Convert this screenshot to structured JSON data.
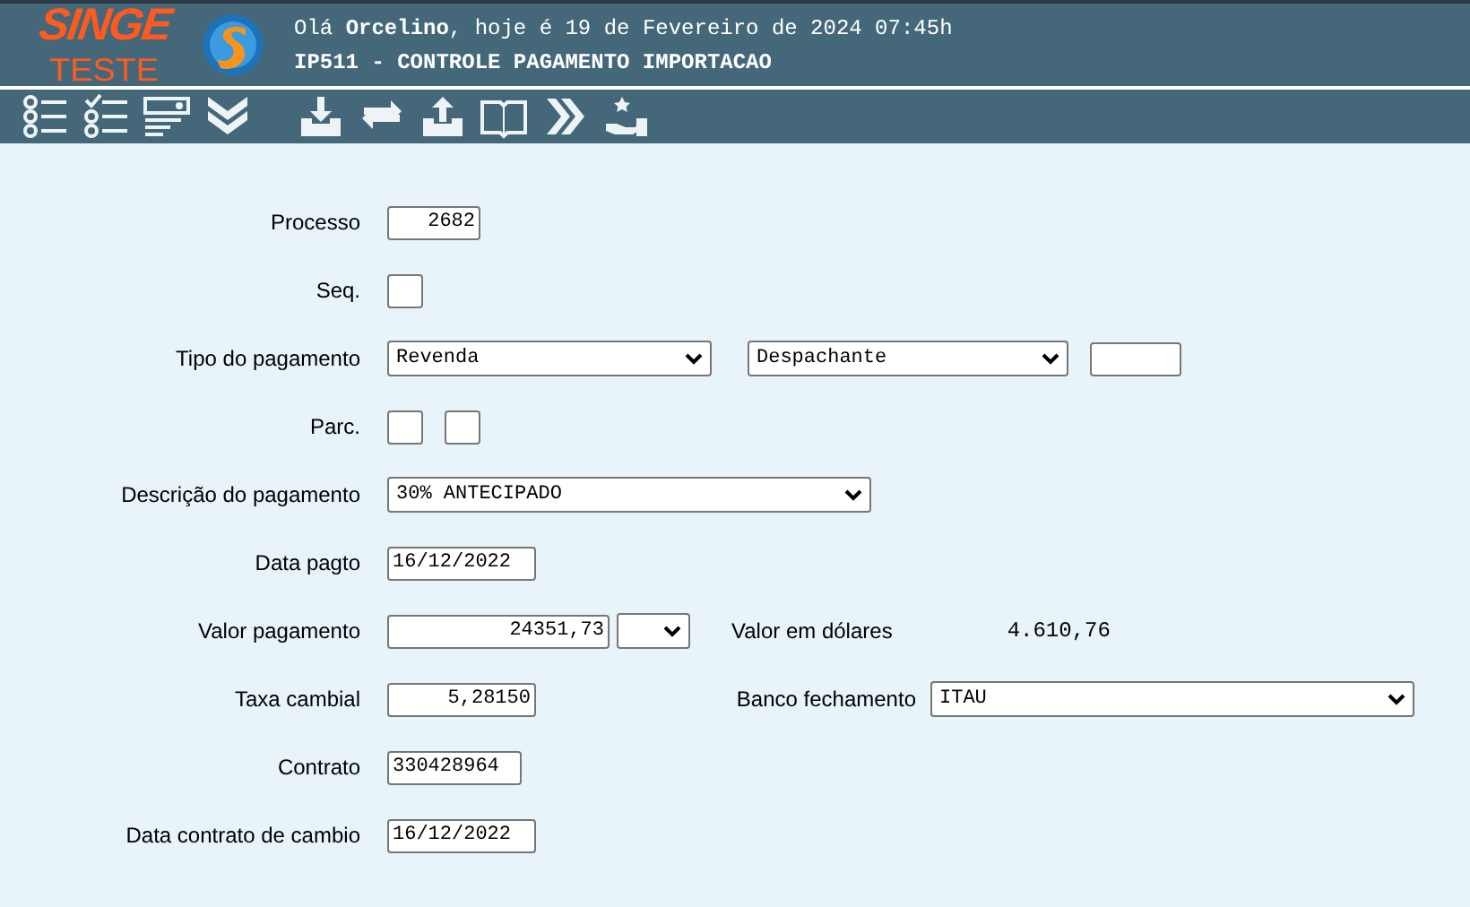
{
  "header": {
    "logo_top": "SINGE",
    "logo_bottom": "TESTE",
    "greeting": "Olá **Orcelino**, hoje é 19 de Fevereiro de 2024 07:45h",
    "title": "IP511 - CONTROLE PAGAMENTO IMPORTACAO"
  },
  "form": {
    "rows": [
      {
        "label": "Processo",
        "fields": [
          {
            "kind": "input",
            "value": "2682"
          }
        ]
      },
      {
        "label": "Seq.",
        "fields": [
          {
            "kind": "input"
          }
        ]
      },
      {
        "label": "Tipo do pagamento",
        "fields": [
          {
            "kind": "select",
            "value": "Revenda"
          },
          {
            "kind": "select",
            "value": "Despachante"
          },
          {
            "kind": "input"
          }
        ]
      },
      {
        "label": "Parc.",
        "fields": [
          {
            "kind": "input"
          },
          {
            "kind": "input"
          }
        ]
      },
      {
        "label": "Descrição do pagamento",
        "fields": [
          {
            "kind": "select",
            "value": "30% ANTECIPADO"
          }
        ]
      },
      {
        "label": "Data pagto",
        "fields": [
          {
            "kind": "input",
            "value": "16/12/2022"
          }
        ]
      },
      {
        "label": "Valor pagamento",
        "fields": [
          {
            "kind": "input",
            "value": "24351,73"
          },
          {
            "kind": "select"
          },
          {
            "kind": "label",
            "value": "Valor em dólares"
          },
          {
            "kind": "output",
            "value": "4.610,76"
          }
        ]
      },
      {
        "label": "Taxa cambial",
        "fields": [
          {
            "kind": "input",
            "value": "5,28150"
          },
          {
            "kind": "label",
            "value": "Banco fechamento"
          },
          {
            "kind": "select",
            "value": "ITAU"
          }
        ]
      },
      {
        "label": "Contrato",
        "fields": [
          {
            "kind": "input",
            "value": "330428964"
          }
        ]
      },
      {
        "label": "Data contrato de cambio",
        "fields": [
          {
            "kind": "input",
            "value": "16/12/2022"
          }
        ]
      }
    ]
  }
}
